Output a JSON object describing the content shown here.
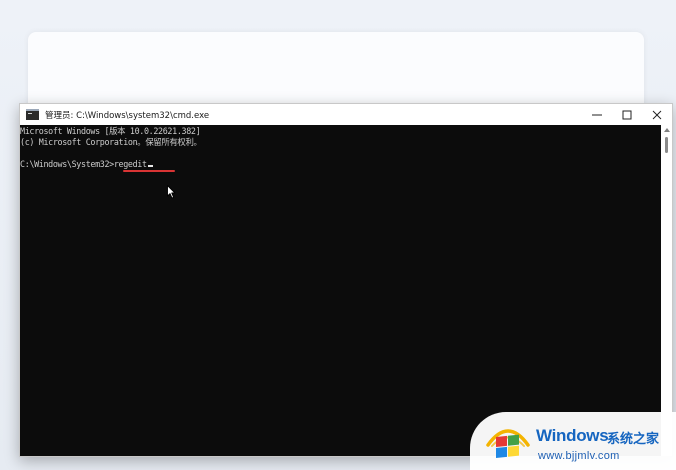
{
  "window": {
    "title": "管理员: C:\\Windows\\system32\\cmd.exe",
    "icon": "cmd-icon",
    "minimize_glyph": "—",
    "maximize_glyph": "☐",
    "close_glyph": "✕"
  },
  "console": {
    "lines": [
      "Microsoft Windows [版本 10.0.22621.382]",
      "(c) Microsoft Corporation。保留所有权利。",
      ""
    ],
    "prompt": "C:\\Windows\\System32>",
    "typed_command": "regedit"
  },
  "annotation": {
    "underline_color": "#d93434"
  },
  "watermark": {
    "brand": "Windows",
    "brand_cn": "系统之家",
    "url": "www.bjjmlv.com"
  },
  "colors": {
    "console_bg": "#0c0c0c",
    "console_text": "#cccccc",
    "accent_blue": "#1565c0"
  }
}
